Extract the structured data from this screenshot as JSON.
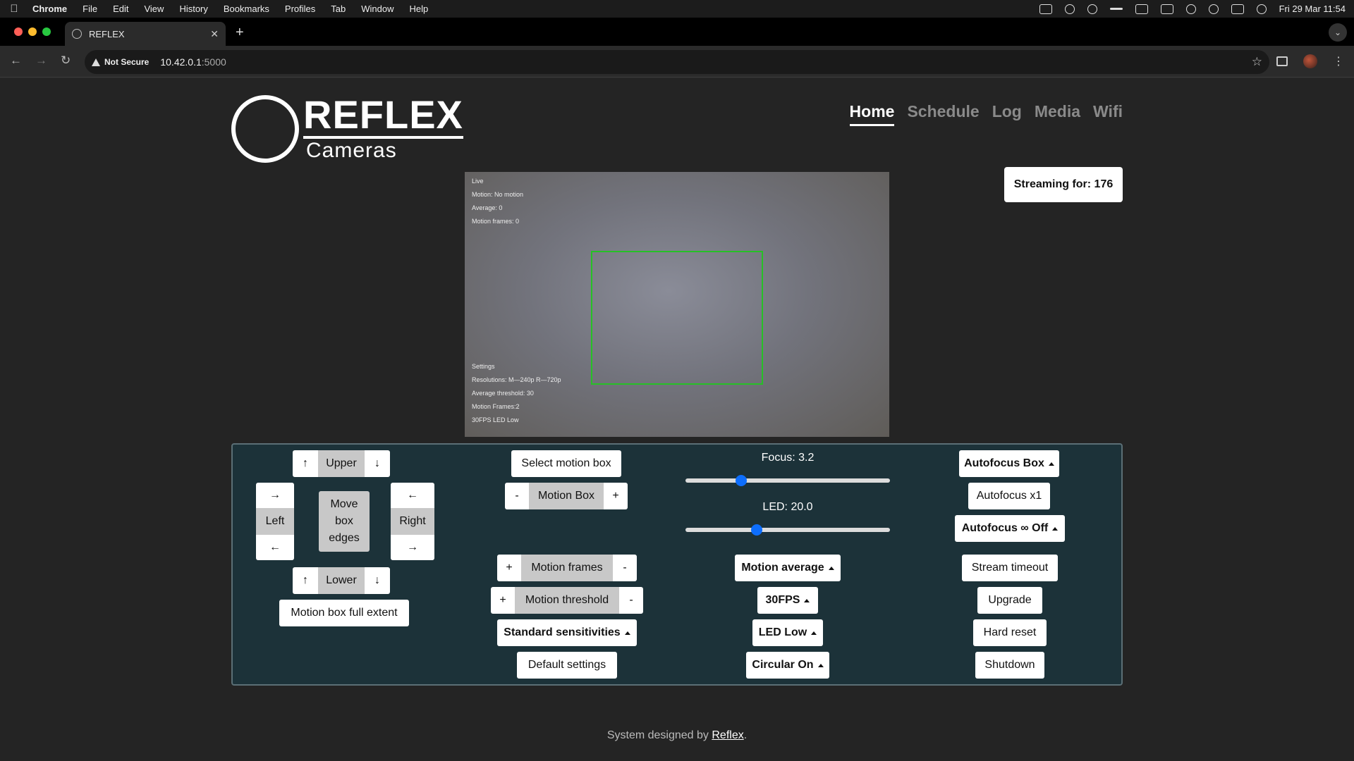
{
  "menubar": {
    "items": [
      "Chrome",
      "File",
      "Edit",
      "View",
      "History",
      "Bookmarks",
      "Profiles",
      "Tab",
      "Window",
      "Help"
    ],
    "datetime": "Fri 29 Mar  11:54"
  },
  "browser": {
    "tab_title": "REFLEX",
    "security_label": "Not Secure",
    "url_host": "10.42.0.1",
    "url_port": ":5000"
  },
  "site": {
    "logo_big": "REFLEX",
    "logo_small": "Cameras",
    "nav": [
      "Home",
      "Schedule",
      "Log",
      "Media",
      "Wifi"
    ],
    "active_nav": "Home",
    "streaming": "Streaming for: 176"
  },
  "video": {
    "osd_top": [
      "Live",
      "Motion: No motion",
      "Average: 0",
      "Motion frames: 0"
    ],
    "osd_bottom": [
      "Settings",
      "Resolutions: M—240p R—720p",
      "Average threshold: 30",
      "Motion Frames:2",
      "30FPS      LED Low"
    ]
  },
  "controls": {
    "upper": "Upper",
    "lower": "Lower",
    "left": "Left",
    "right": "Right",
    "move_box": "Move box edges",
    "full_extent": "Motion box full extent",
    "select_motion_box": "Select motion box",
    "motion_box": "Motion Box",
    "motion_frames": "Motion frames",
    "motion_threshold": "Motion threshold",
    "standard_sensitivities": "Standard sensitivities",
    "default_settings": "Default settings",
    "focus_label": "Focus: 3.2",
    "led_label": "LED: 20.0",
    "focus_fraction": 0.26,
    "led_fraction": 0.34,
    "motion_average": "Motion average",
    "fps": "30FPS",
    "led_low": "LED Low",
    "circular_on": "Circular On",
    "autofocus_box": "Autofocus Box",
    "autofocus_x1": "Autofocus x1",
    "autofocus_inf_off": "Autofocus ∞ Off",
    "stream_timeout": "Stream timeout",
    "upgrade": "Upgrade",
    "hard_reset": "Hard reset",
    "shutdown": "Shutdown",
    "plus": "+",
    "minus": "-",
    "arrow_up": "↑",
    "arrow_down": "↓",
    "arrow_left": "←",
    "arrow_right": "→"
  },
  "footer": {
    "prefix": "System designed by ",
    "link": "Reflex",
    "suffix": "."
  },
  "colors": {
    "panel_bg": "#1c3239",
    "motion_box": "#26c026",
    "slider_thumb": "#0d6efd"
  }
}
